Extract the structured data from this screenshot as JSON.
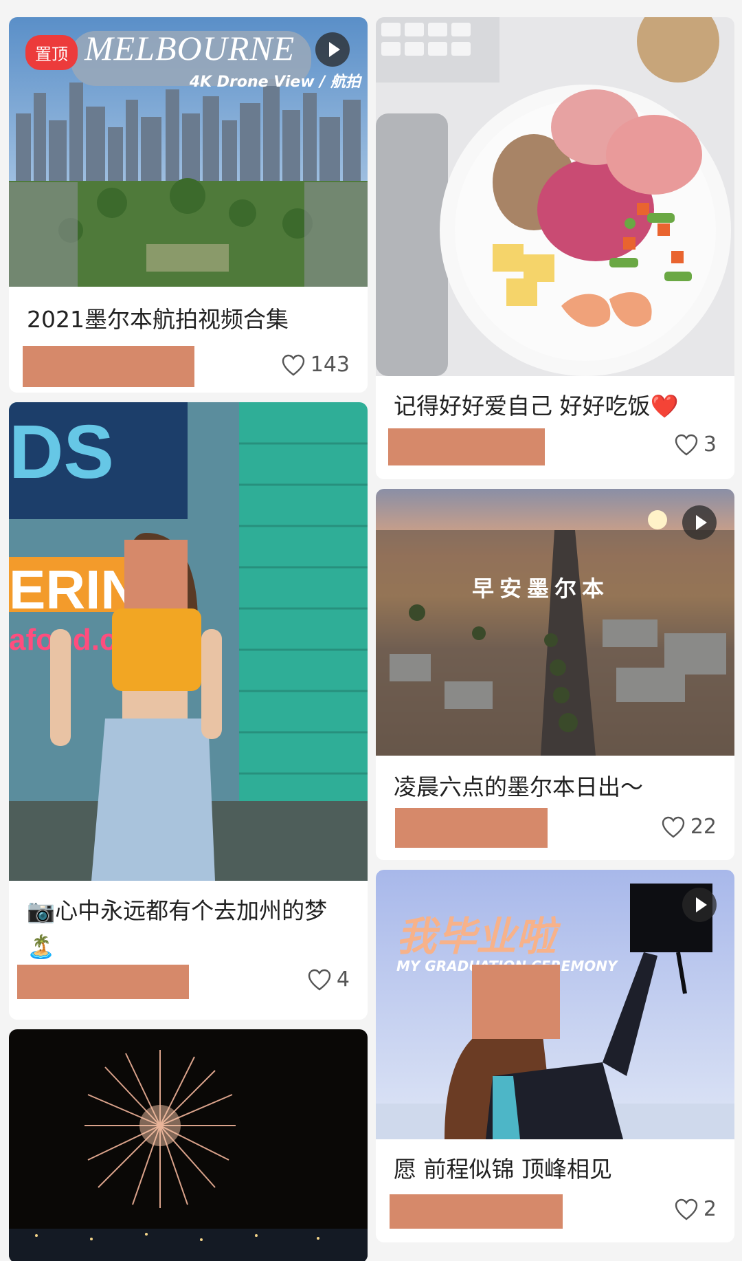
{
  "pinned_badge": "置顶",
  "cards": [
    {
      "caption": "2021墨尔本航拍视频合集",
      "likes": "143",
      "media_title": "MELBOURNE",
      "media_subtitle": "4K Drone View / 航拍"
    },
    {
      "caption": "记得好好爱自己 好好吃饭❤️",
      "likes": "3"
    },
    {
      "caption": "📷心中永远都有个去加州的梦🏝️",
      "likes": "4"
    },
    {
      "caption": "凌晨六点的墨尔本日出～",
      "likes": "22",
      "media_title": "早安墨尔本"
    },
    {
      "caption": "愿 前程似锦 顶峰相见",
      "likes": "2",
      "media_title": "我毕业啦",
      "media_subtitle": "MY GRADUATION CEREMONY"
    },
    {}
  ],
  "colors": {
    "pin_red": "#ec3b3b",
    "redaction": "#d6896a",
    "background": "#f4f4f4"
  },
  "icons": [
    "heart-icon",
    "play-icon"
  ]
}
